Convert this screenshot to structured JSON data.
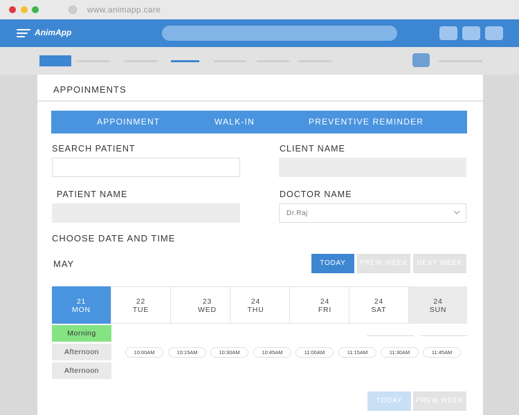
{
  "browser": {
    "url": "www.animapp.care",
    "traffic_colors": [
      "#e0393e",
      "#f3c12f",
      "#3fb54c"
    ]
  },
  "app": {
    "brand": "AnimApp",
    "accent": "#3d86d1"
  },
  "card": {
    "title": "APPOINMENTS"
  },
  "tabs": [
    "APPOINMENT",
    "WALK-IN",
    "PREVENTIVE REMINDER"
  ],
  "form": {
    "search_patient_label": "SEARCH PATIENT",
    "search_patient_value": "",
    "client_name_label": "CLIENT NAME",
    "client_name_value": "",
    "patient_name_label": "PATIENT NAME",
    "patient_name_value": "",
    "doctor_name_label": "DOCTOR NAME",
    "doctor_name_value": "Dr.Raj"
  },
  "schedule": {
    "section_label": "CHOOSE DATE AND TIME",
    "month": "MAY",
    "buttons": [
      "TODAY",
      "PREW WEEK",
      "NEXT WEEK"
    ],
    "days": [
      {
        "date": "21",
        "day": "MON"
      },
      {
        "date": "22",
        "day": "TUE"
      },
      {
        "date": "23",
        "day": "WED"
      },
      {
        "date": "24",
        "day": "THU"
      },
      {
        "date": "24",
        "day": "FRI"
      },
      {
        "date": "24",
        "day": "SAT"
      },
      {
        "date": "24",
        "day": "SUN"
      }
    ],
    "periods": [
      "Morning",
      "Afternoon",
      "Afternoon"
    ],
    "slots": [
      "10:00AM",
      "10:15AM",
      "10:30AM",
      "10:45AM",
      "11:00AM",
      "11:15AM",
      "11:30AM",
      "11:45AM"
    ],
    "bottom_buttons": [
      "TODAY",
      "PREW WEEK"
    ],
    "morning_color": "#86e383"
  }
}
